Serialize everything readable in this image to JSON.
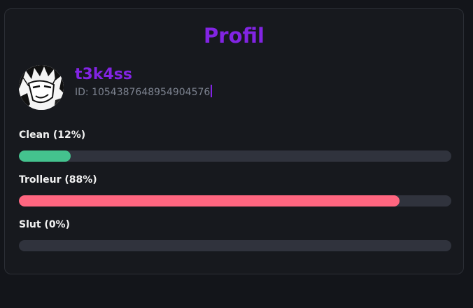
{
  "profile": {
    "title": "Profil",
    "username": "t3k4ss",
    "user_id_text": "ID: 1054387648954904576"
  },
  "stats": [
    {
      "label": "Clean (12%)",
      "value": 0.12,
      "color": "#44c28e"
    },
    {
      "label": "Trolleur (88%)",
      "value": 0.88,
      "color": "#ff6680"
    },
    {
      "label": "Slut (0%)",
      "value": 0.0,
      "color": "#e84fa0"
    }
  ],
  "colors": {
    "accent": "#8224e3",
    "background": "#13151a",
    "card": "#17191e",
    "track": "#30333d"
  },
  "icons": {
    "avatar": "manga-character-avatar"
  }
}
